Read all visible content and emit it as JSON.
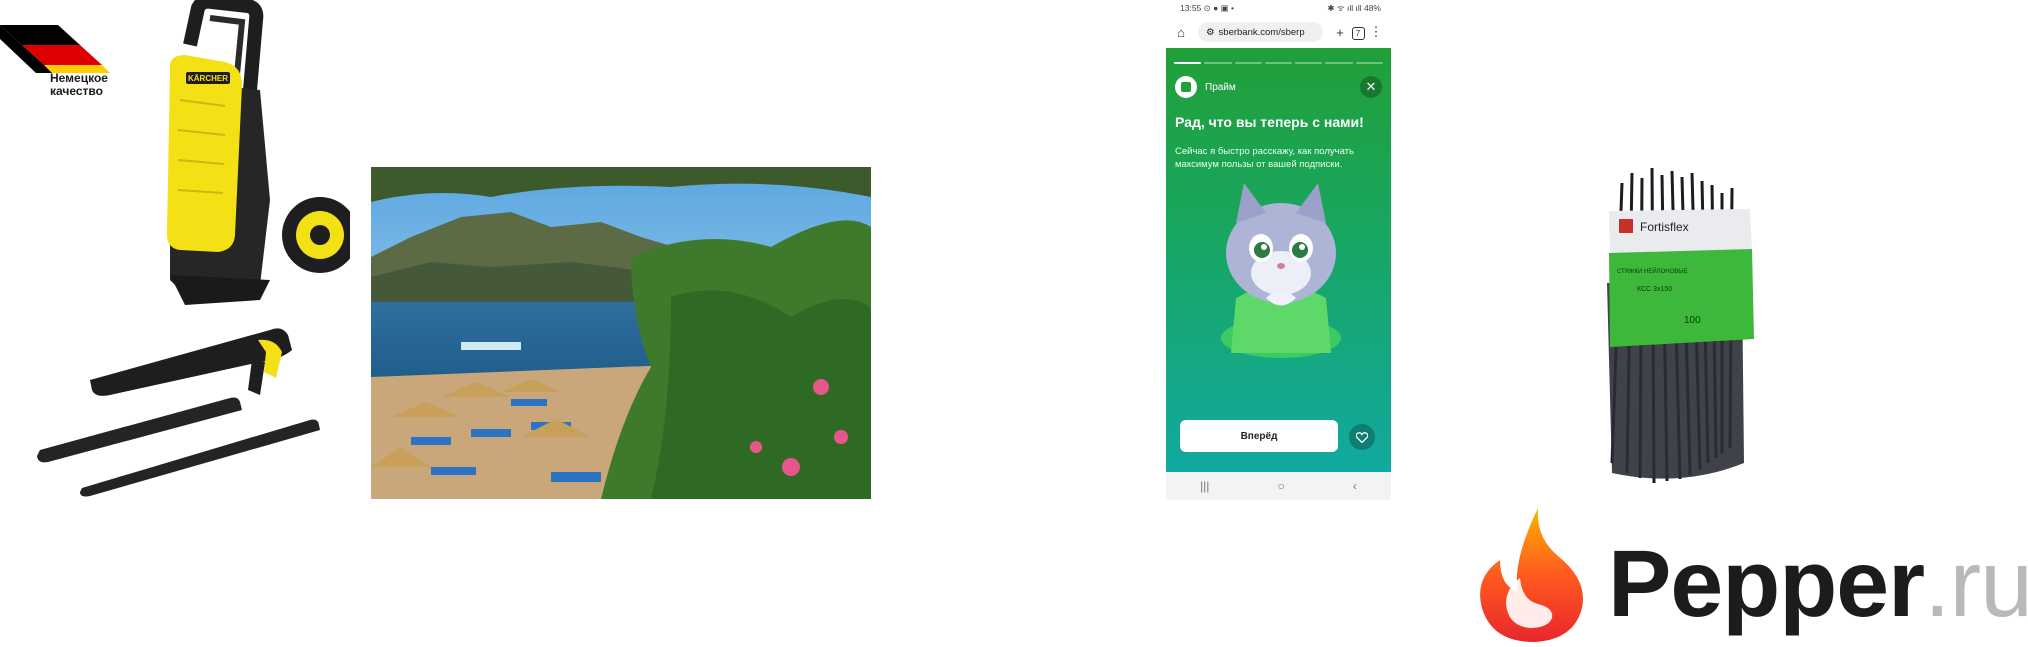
{
  "german_badge": {
    "line1": "Немецкое",
    "line2": "качество",
    "colors": [
      "#000000",
      "#dd0000",
      "#ffce00"
    ]
  },
  "karcher": {
    "brand": "KÄRCHER",
    "accent": "#f5e616"
  },
  "beach_photo": {
    "subject": "beach"
  },
  "phone": {
    "status": {
      "time": "13:55",
      "left_icons": "⊙ ● ▣ •",
      "right": "✱ ᯤ ıll ıll 48%"
    },
    "browser": {
      "url": "sberbank.com/sberp",
      "tabs": "7",
      "home_icon": "⌂",
      "add_icon": "+",
      "menu_icon": "⋮"
    },
    "story": {
      "brand": "Прайм",
      "title": "Рад, что вы теперь с нами!",
      "subtitle": "Сейчас я быстро расскажу, как получать максимум пользы от вашей подписки.",
      "button": "Вперёд",
      "progress_segments": 7,
      "progress_current": 1,
      "gradient_top": "#21a038",
      "gradient_bottom": "#12a9a0"
    },
    "nav": {
      "recent": "|||",
      "home": "○",
      "back": "‹"
    }
  },
  "ties": {
    "brand": "Fortisflex",
    "label_text": "СТЯЖКИ НЕЙЛОНОВЫЕ",
    "size": "КСС 3x150",
    "count": "100"
  },
  "pepper": {
    "name": "Pepper",
    "tld": ".ru",
    "flame_colors": [
      "#ffb200",
      "#ff5a1f",
      "#e8262d"
    ]
  }
}
